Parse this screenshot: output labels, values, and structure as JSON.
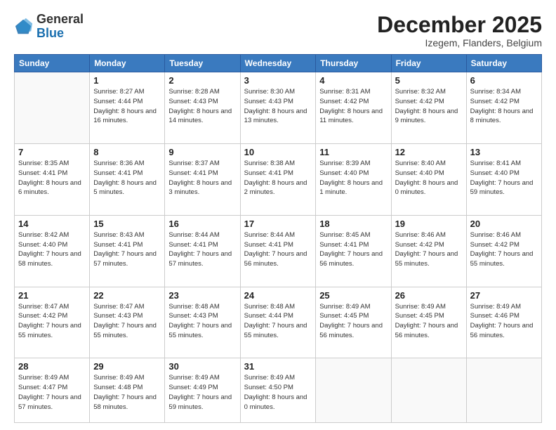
{
  "header": {
    "logo_general": "General",
    "logo_blue": "Blue",
    "month_title": "December 2025",
    "location": "Izegem, Flanders, Belgium"
  },
  "days_of_week": [
    "Sunday",
    "Monday",
    "Tuesday",
    "Wednesday",
    "Thursday",
    "Friday",
    "Saturday"
  ],
  "weeks": [
    [
      {
        "num": "",
        "sunrise": "",
        "sunset": "",
        "daylight": ""
      },
      {
        "num": "1",
        "sunrise": "Sunrise: 8:27 AM",
        "sunset": "Sunset: 4:44 PM",
        "daylight": "Daylight: 8 hours and 16 minutes."
      },
      {
        "num": "2",
        "sunrise": "Sunrise: 8:28 AM",
        "sunset": "Sunset: 4:43 PM",
        "daylight": "Daylight: 8 hours and 14 minutes."
      },
      {
        "num": "3",
        "sunrise": "Sunrise: 8:30 AM",
        "sunset": "Sunset: 4:43 PM",
        "daylight": "Daylight: 8 hours and 13 minutes."
      },
      {
        "num": "4",
        "sunrise": "Sunrise: 8:31 AM",
        "sunset": "Sunset: 4:42 PM",
        "daylight": "Daylight: 8 hours and 11 minutes."
      },
      {
        "num": "5",
        "sunrise": "Sunrise: 8:32 AM",
        "sunset": "Sunset: 4:42 PM",
        "daylight": "Daylight: 8 hours and 9 minutes."
      },
      {
        "num": "6",
        "sunrise": "Sunrise: 8:34 AM",
        "sunset": "Sunset: 4:42 PM",
        "daylight": "Daylight: 8 hours and 8 minutes."
      }
    ],
    [
      {
        "num": "7",
        "sunrise": "Sunrise: 8:35 AM",
        "sunset": "Sunset: 4:41 PM",
        "daylight": "Daylight: 8 hours and 6 minutes."
      },
      {
        "num": "8",
        "sunrise": "Sunrise: 8:36 AM",
        "sunset": "Sunset: 4:41 PM",
        "daylight": "Daylight: 8 hours and 5 minutes."
      },
      {
        "num": "9",
        "sunrise": "Sunrise: 8:37 AM",
        "sunset": "Sunset: 4:41 PM",
        "daylight": "Daylight: 8 hours and 3 minutes."
      },
      {
        "num": "10",
        "sunrise": "Sunrise: 8:38 AM",
        "sunset": "Sunset: 4:41 PM",
        "daylight": "Daylight: 8 hours and 2 minutes."
      },
      {
        "num": "11",
        "sunrise": "Sunrise: 8:39 AM",
        "sunset": "Sunset: 4:40 PM",
        "daylight": "Daylight: 8 hours and 1 minute."
      },
      {
        "num": "12",
        "sunrise": "Sunrise: 8:40 AM",
        "sunset": "Sunset: 4:40 PM",
        "daylight": "Daylight: 8 hours and 0 minutes."
      },
      {
        "num": "13",
        "sunrise": "Sunrise: 8:41 AM",
        "sunset": "Sunset: 4:40 PM",
        "daylight": "Daylight: 7 hours and 59 minutes."
      }
    ],
    [
      {
        "num": "14",
        "sunrise": "Sunrise: 8:42 AM",
        "sunset": "Sunset: 4:40 PM",
        "daylight": "Daylight: 7 hours and 58 minutes."
      },
      {
        "num": "15",
        "sunrise": "Sunrise: 8:43 AM",
        "sunset": "Sunset: 4:41 PM",
        "daylight": "Daylight: 7 hours and 57 minutes."
      },
      {
        "num": "16",
        "sunrise": "Sunrise: 8:44 AM",
        "sunset": "Sunset: 4:41 PM",
        "daylight": "Daylight: 7 hours and 57 minutes."
      },
      {
        "num": "17",
        "sunrise": "Sunrise: 8:44 AM",
        "sunset": "Sunset: 4:41 PM",
        "daylight": "Daylight: 7 hours and 56 minutes."
      },
      {
        "num": "18",
        "sunrise": "Sunrise: 8:45 AM",
        "sunset": "Sunset: 4:41 PM",
        "daylight": "Daylight: 7 hours and 56 minutes."
      },
      {
        "num": "19",
        "sunrise": "Sunrise: 8:46 AM",
        "sunset": "Sunset: 4:42 PM",
        "daylight": "Daylight: 7 hours and 55 minutes."
      },
      {
        "num": "20",
        "sunrise": "Sunrise: 8:46 AM",
        "sunset": "Sunset: 4:42 PM",
        "daylight": "Daylight: 7 hours and 55 minutes."
      }
    ],
    [
      {
        "num": "21",
        "sunrise": "Sunrise: 8:47 AM",
        "sunset": "Sunset: 4:42 PM",
        "daylight": "Daylight: 7 hours and 55 minutes."
      },
      {
        "num": "22",
        "sunrise": "Sunrise: 8:47 AM",
        "sunset": "Sunset: 4:43 PM",
        "daylight": "Daylight: 7 hours and 55 minutes."
      },
      {
        "num": "23",
        "sunrise": "Sunrise: 8:48 AM",
        "sunset": "Sunset: 4:43 PM",
        "daylight": "Daylight: 7 hours and 55 minutes."
      },
      {
        "num": "24",
        "sunrise": "Sunrise: 8:48 AM",
        "sunset": "Sunset: 4:44 PM",
        "daylight": "Daylight: 7 hours and 55 minutes."
      },
      {
        "num": "25",
        "sunrise": "Sunrise: 8:49 AM",
        "sunset": "Sunset: 4:45 PM",
        "daylight": "Daylight: 7 hours and 56 minutes."
      },
      {
        "num": "26",
        "sunrise": "Sunrise: 8:49 AM",
        "sunset": "Sunset: 4:45 PM",
        "daylight": "Daylight: 7 hours and 56 minutes."
      },
      {
        "num": "27",
        "sunrise": "Sunrise: 8:49 AM",
        "sunset": "Sunset: 4:46 PM",
        "daylight": "Daylight: 7 hours and 56 minutes."
      }
    ],
    [
      {
        "num": "28",
        "sunrise": "Sunrise: 8:49 AM",
        "sunset": "Sunset: 4:47 PM",
        "daylight": "Daylight: 7 hours and 57 minutes."
      },
      {
        "num": "29",
        "sunrise": "Sunrise: 8:49 AM",
        "sunset": "Sunset: 4:48 PM",
        "daylight": "Daylight: 7 hours and 58 minutes."
      },
      {
        "num": "30",
        "sunrise": "Sunrise: 8:49 AM",
        "sunset": "Sunset: 4:49 PM",
        "daylight": "Daylight: 7 hours and 59 minutes."
      },
      {
        "num": "31",
        "sunrise": "Sunrise: 8:49 AM",
        "sunset": "Sunset: 4:50 PM",
        "daylight": "Daylight: 8 hours and 0 minutes."
      },
      {
        "num": "",
        "sunrise": "",
        "sunset": "",
        "daylight": ""
      },
      {
        "num": "",
        "sunrise": "",
        "sunset": "",
        "daylight": ""
      },
      {
        "num": "",
        "sunrise": "",
        "sunset": "",
        "daylight": ""
      }
    ]
  ]
}
